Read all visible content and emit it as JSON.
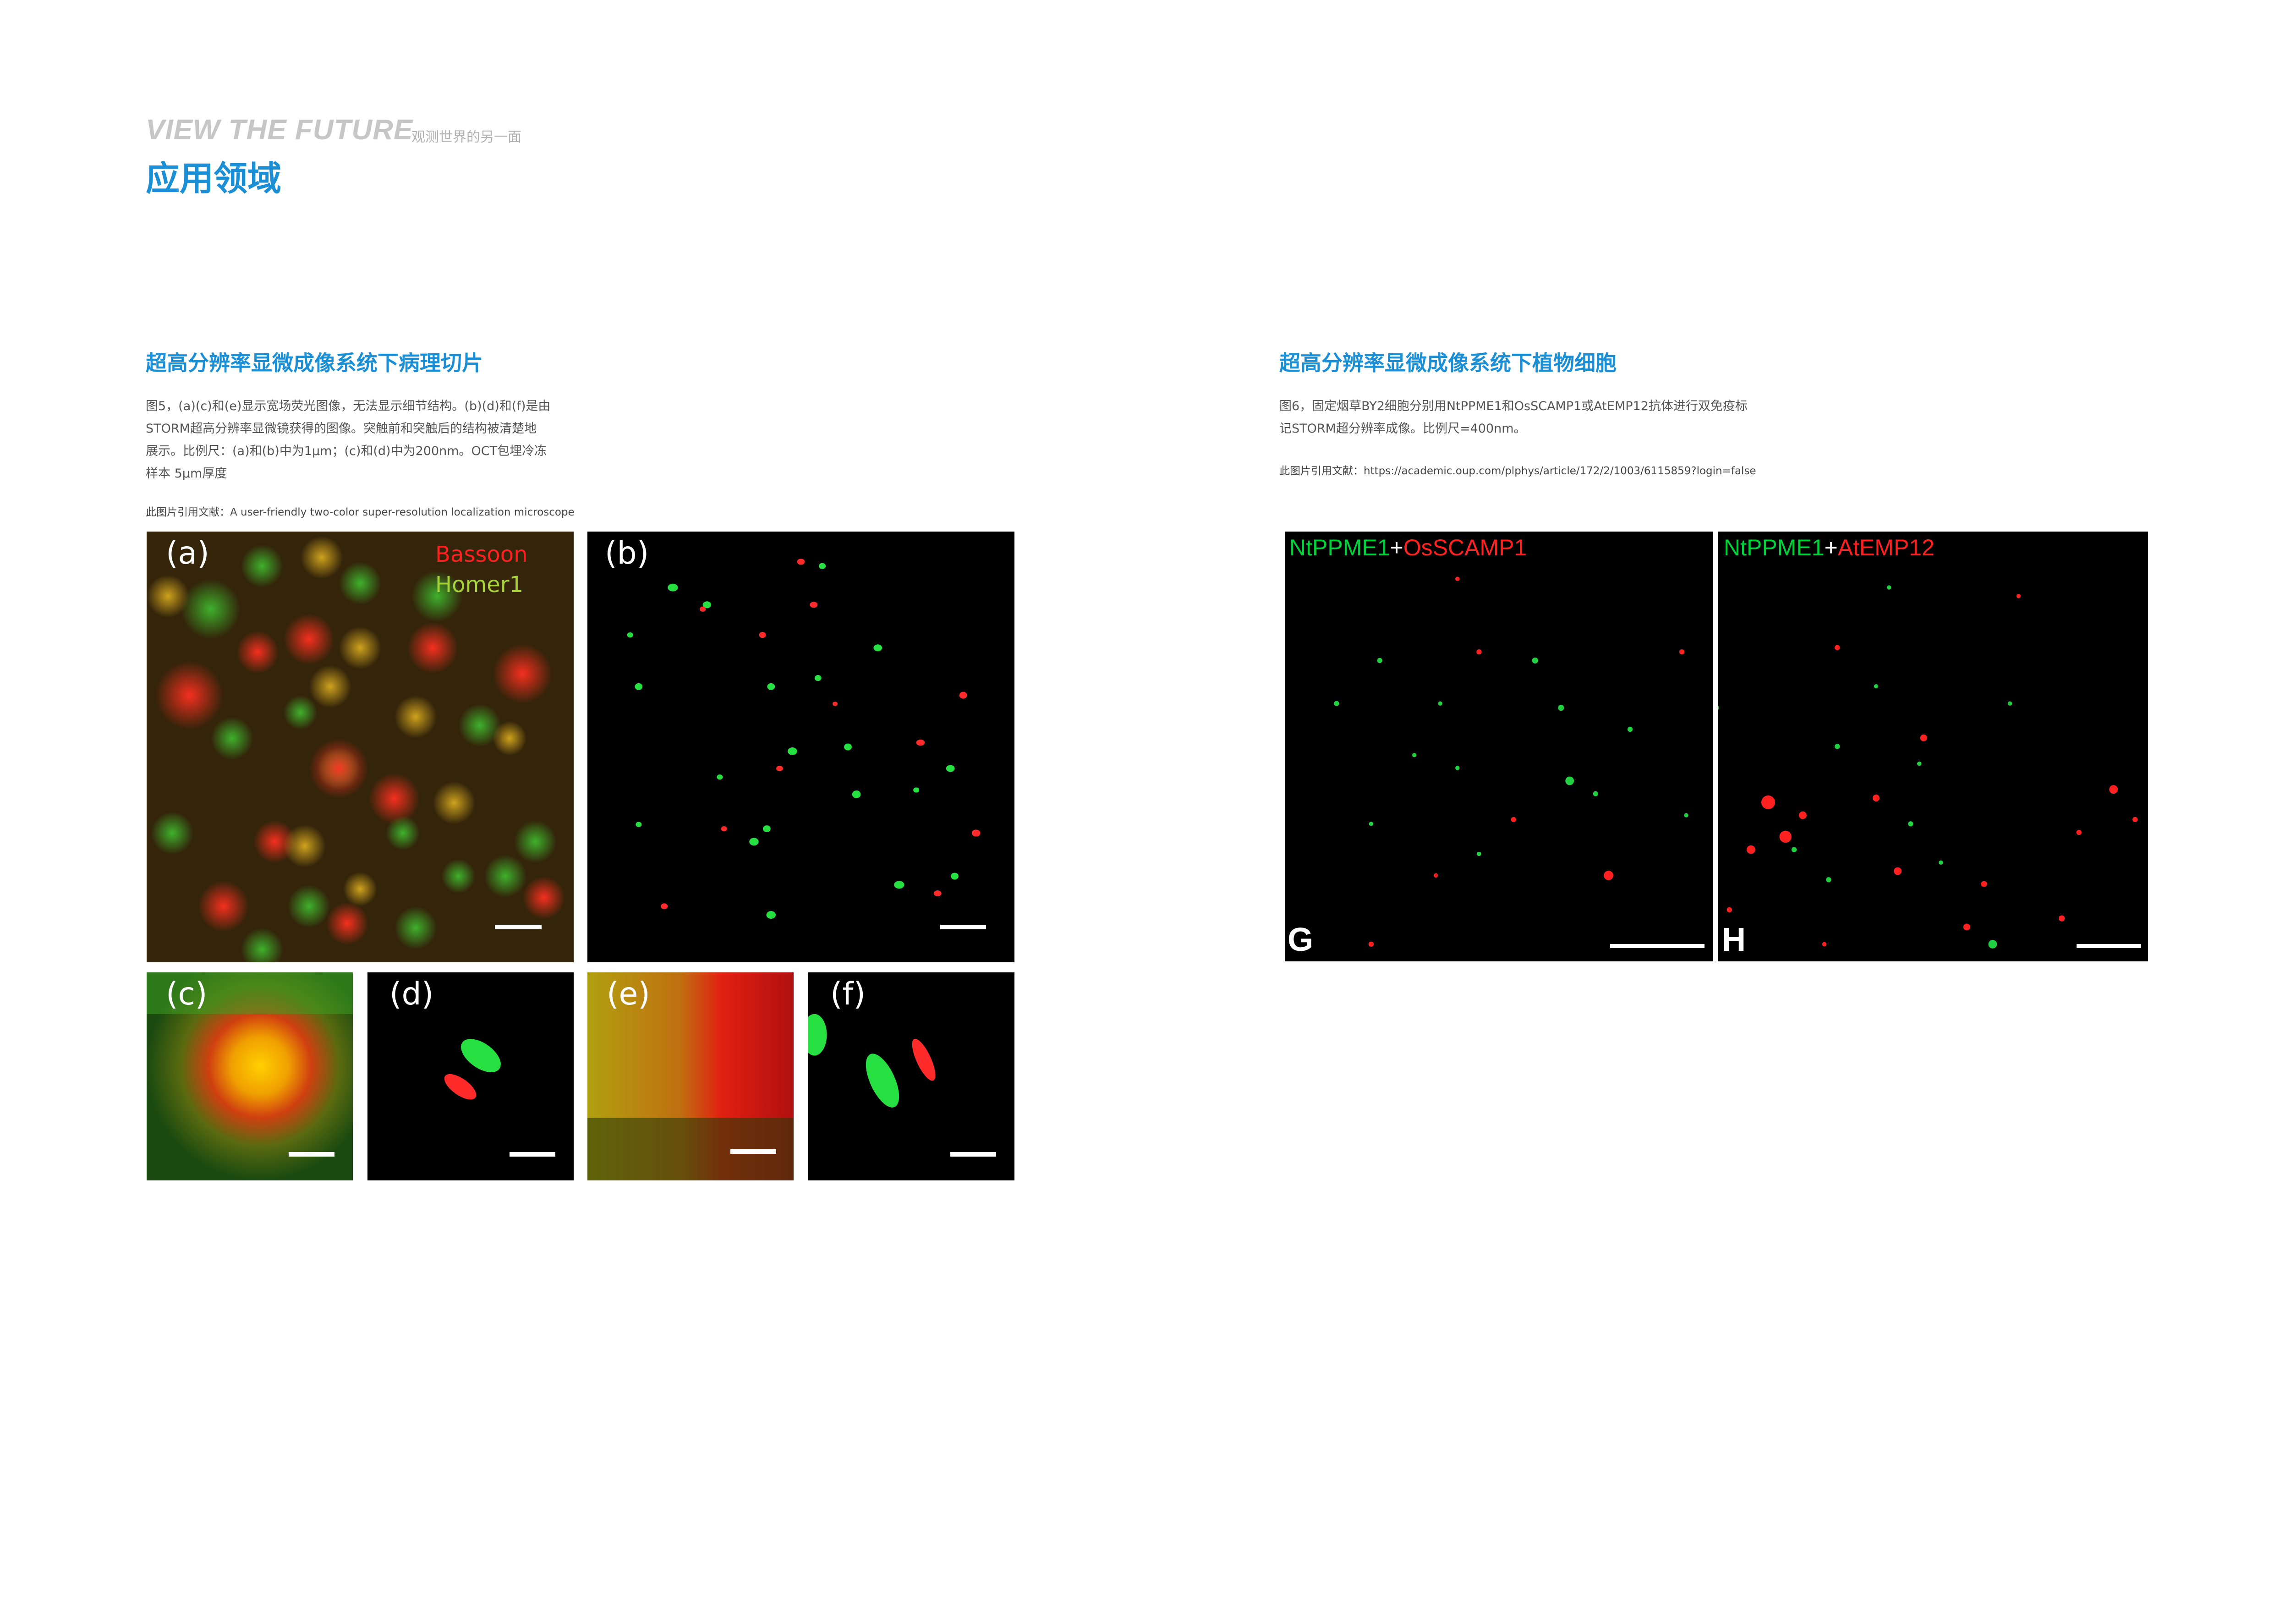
{
  "header": {
    "slogan": "VIEW THE FUTURE",
    "slogan_sub": "观测世界的另一面",
    "title": "应用领域"
  },
  "left_section": {
    "title": "超高分辨率显微成像系统下病理切片",
    "caption_lines": [
      "图5，(a)(c)和(e)显示宽场荧光图像，无法显示细节结构。(b)(d)和(f)是由",
      "STORM超高分辨率显微镜获得的图像。突触前和突触后的结构被清楚地",
      "展示。比例尺：(a)和(b)中为1μm；(c)和(d)中为200nm。OCT包埋冷冻",
      "样本 5μm厚度"
    ],
    "reference": "此图片引用文献：A user-friendly two-color super-resolution localization microscope",
    "panel_labels": {
      "a": "(a)",
      "b": "(b)",
      "c": "(c)",
      "d": "(d)",
      "e": "(e)",
      "f": "(f)"
    },
    "legend": {
      "red": "Bassoon",
      "green": "Homer1",
      "red_color": "#ff2020",
      "green_color": "#a8d23a"
    }
  },
  "right_section": {
    "title": "超高分辨率显微成像系统下植物细胞",
    "caption_lines": [
      "图6，固定烟草BY2细胞分别用NtPPME1和OsSCAMP1或AtEMP12抗体进行双免疫标",
      "记STORM超分辨率成像。比例尺=400nm。"
    ],
    "reference": "此图片引用文献：https://academic.oup.com/plphys/article/172/2/1003/6115859?login=false",
    "panel_G": {
      "green": "NtPPME1",
      "plus": "+",
      "red": "OsSCAMP1",
      "letter": "G"
    },
    "panel_H": {
      "green": "NtPPME1",
      "plus": "+",
      "red": "AtEMP12",
      "letter": "H"
    }
  },
  "colors": {
    "accent": "#1b8fd6",
    "slogan": "#c6c6c6",
    "label_green": "#00d23c",
    "label_red": "#ff2020"
  }
}
